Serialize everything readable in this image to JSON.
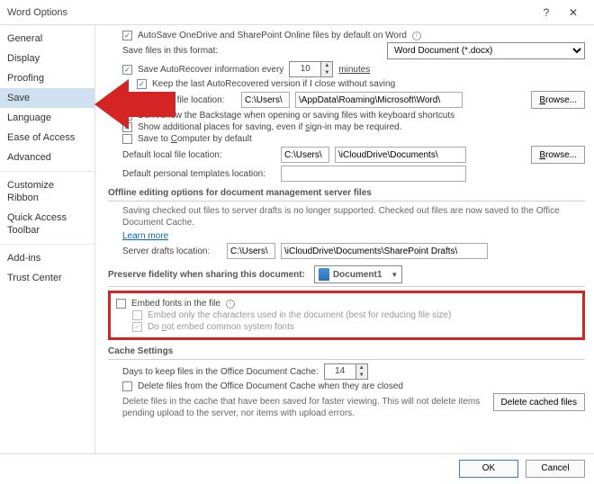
{
  "window": {
    "title": "Word Options",
    "help": "?",
    "close": "✕"
  },
  "sidebar": {
    "items": [
      "General",
      "Display",
      "Proofing",
      "Save",
      "Language",
      "Ease of Access",
      "Advanced",
      "Customize Ribbon",
      "Quick Access Toolbar",
      "Add-ins",
      "Trust Center"
    ],
    "selected_index": 3
  },
  "save": {
    "autosave_label": "AutoSave OneDrive and SharePoint Online files by default on Word",
    "save_format_label": "Save files in this format:",
    "save_format_value": "Word Document (*.docx)",
    "autorecover_pre": "Save AutoRecover information every",
    "autorecover_minutes": "10",
    "autorecover_post": "minutes",
    "keep_last": "Keep the last AutoRecovered version if I close without saving",
    "autorecover_loc_label": "AutoRecover file location:",
    "autorecover_loc_a": "C:\\Users\\",
    "autorecover_loc_b": "\\AppData\\Roaming\\Microsoft\\Word\\",
    "browse": "Browse...",
    "dont_show_backstage": "Don't show the Backstage when opening or saving files with keyboard shortcuts",
    "show_additional": "Show additional places for saving, even if sign-in may be required.",
    "save_computer": "Save to Computer by default",
    "default_local_label": "Default local file location:",
    "default_local_a": "C:\\Users\\",
    "default_local_b": "\\iCloudDrive\\Documents\\",
    "default_template_label": "Default personal templates location:",
    "default_template_value": ""
  },
  "offline": {
    "header": "Offline editing options for document management server files",
    "note": "Saving checked out files to server drafts is no longer supported. Checked out files are now saved to the Office Document Cache.",
    "learn_more": "Learn more",
    "drafts_label": "Server drafts location:",
    "drafts_a": "C:\\Users\\",
    "drafts_b": "\\iCloudDrive\\Documents\\SharePoint Drafts\\"
  },
  "fidelity": {
    "header": "Preserve fidelity when sharing this document:",
    "doc": "Document1",
    "embed_fonts": "Embed fonts in the file",
    "embed_chars": "Embed only the characters used in the document (best for reducing file size)",
    "no_common": "Do not embed common system fonts"
  },
  "cache": {
    "header": "Cache Settings",
    "days_label": "Days to keep files in the Office Document Cache:",
    "days_value": "14",
    "delete_closed": "Delete files from the Office Document Cache when they are closed",
    "delete_note": "Delete files in the cache that have been saved for faster viewing. This will not delete items pending upload to the server, nor items with upload errors.",
    "delete_btn": "Delete cached files"
  },
  "footer": {
    "ok": "OK",
    "cancel": "Cancel"
  }
}
